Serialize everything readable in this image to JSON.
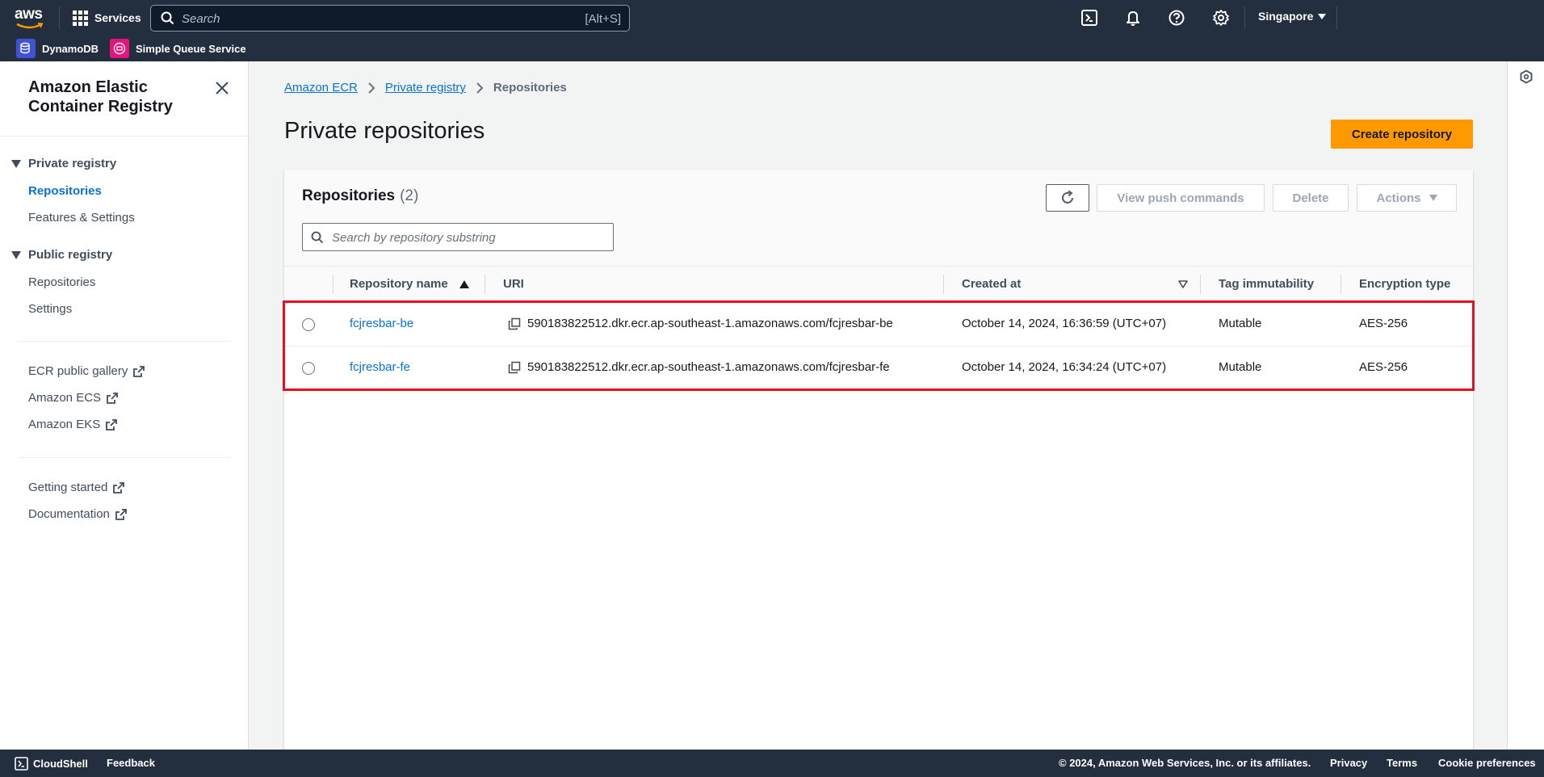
{
  "topnav": {
    "services_label": "Services",
    "search_placeholder": "Search",
    "search_shortcut": "[Alt+S]",
    "region_label": "Singapore",
    "favorites": [
      {
        "label": "DynamoDB",
        "color": "#4053d6"
      },
      {
        "label": "Simple Queue Service",
        "color": "#e7157b"
      }
    ]
  },
  "sidebar": {
    "title": "Amazon Elastic Container Registry",
    "private_section": "Private registry",
    "private_items": [
      "Repositories",
      "Features & Settings"
    ],
    "public_section": "Public registry",
    "public_items": [
      "Repositories",
      "Settings"
    ],
    "external_links": [
      "ECR public gallery",
      "Amazon ECS",
      "Amazon EKS"
    ],
    "help_links": [
      "Getting started",
      "Documentation"
    ]
  },
  "breadcrumb": {
    "items": [
      "Amazon ECR",
      "Private registry"
    ],
    "current": "Repositories"
  },
  "page": {
    "title": "Private repositories",
    "create_button": "Create repository"
  },
  "panel": {
    "title": "Repositories",
    "count": "(2)",
    "view_push_label": "View push commands",
    "delete_label": "Delete",
    "actions_label": "Actions",
    "filter_placeholder": "Search by repository substring"
  },
  "table": {
    "columns": [
      "Repository name",
      "URI",
      "Created at",
      "Tag immutability",
      "Encryption type"
    ],
    "rows": [
      {
        "name": "fcjresbar-be",
        "uri": "590183822512.dkr.ecr.ap-southeast-1.amazonaws.com/fcjresbar-be",
        "created": "October 14, 2024, 16:36:59 (UTC+07)",
        "tag": "Mutable",
        "encryption": "AES-256"
      },
      {
        "name": "fcjresbar-fe",
        "uri": "590183822512.dkr.ecr.ap-southeast-1.amazonaws.com/fcjresbar-fe",
        "created": "October 14, 2024, 16:34:24 (UTC+07)",
        "tag": "Mutable",
        "encryption": "AES-256"
      }
    ]
  },
  "footer": {
    "cloudshell": "CloudShell",
    "feedback": "Feedback",
    "copyright": "© 2024, Amazon Web Services, Inc. or its affiliates.",
    "privacy": "Privacy",
    "terms": "Terms",
    "cookies": "Cookie preferences"
  }
}
